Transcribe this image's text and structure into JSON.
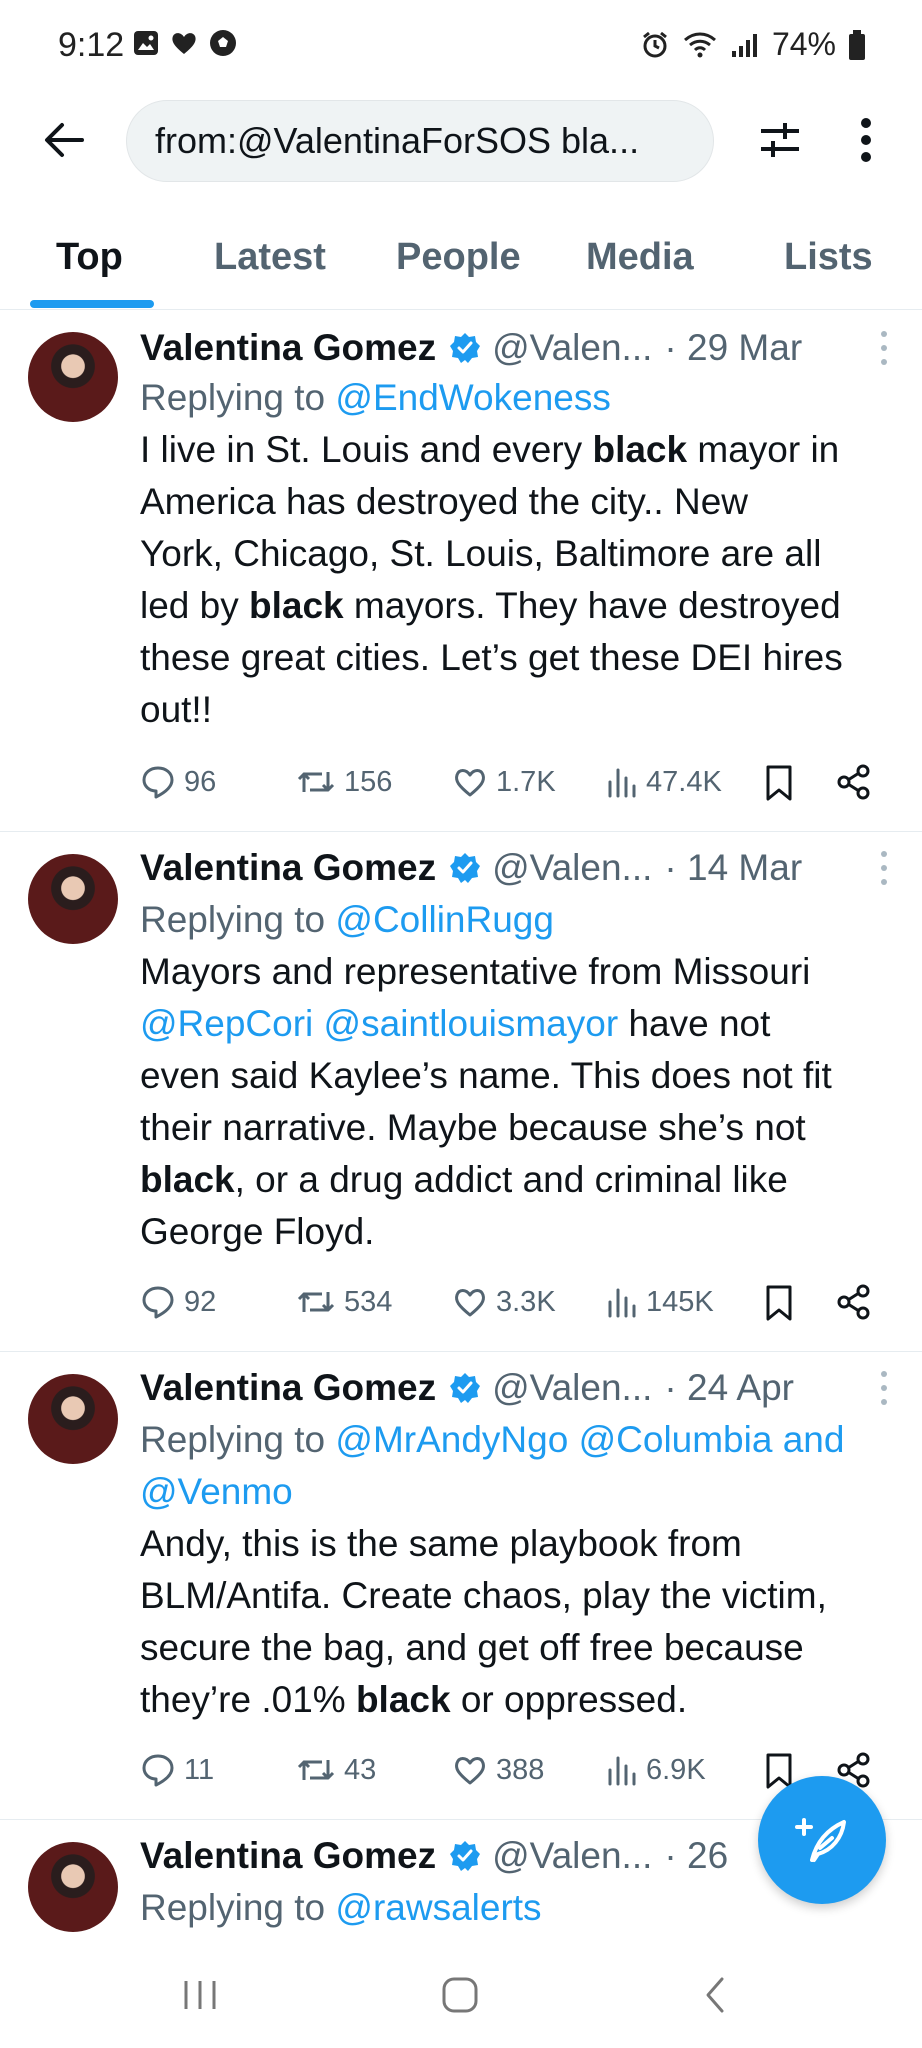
{
  "status_bar": {
    "time": "9:12",
    "battery": "74%"
  },
  "search": {
    "query": "from:@ValentinaForSOS bla..."
  },
  "tabs": [
    {
      "label": "Top",
      "active": true
    },
    {
      "label": "Latest",
      "active": false
    },
    {
      "label": "People",
      "active": false
    },
    {
      "label": "Media",
      "active": false
    },
    {
      "label": "Lists",
      "active": false
    }
  ],
  "tweets": [
    {
      "name": "Valentina Gomez",
      "handle": "@Valen...",
      "date": "· 29 Mar",
      "reply_prefix": "Replying to",
      "reply_mentions": "@EndWokeness",
      "body_lines": [
        [
          "I live in St. Louis and every ",
          "black",
          " mayor in"
        ],
        [
          "America has destroyed the city.. New"
        ],
        [
          "York, Chicago, St. Louis, Baltimore are all"
        ],
        [
          "led by ",
          "black",
          " mayors. They have destroyed"
        ],
        [
          "these great cities. Let’s get these DEI hires"
        ],
        [
          "out!!"
        ]
      ],
      "stats": {
        "replies": "96",
        "retweets": "156",
        "likes": "1.7K",
        "views": "47.4K"
      }
    },
    {
      "name": "Valentina Gomez",
      "handle": "@Valen...",
      "date": "· 14 Mar",
      "reply_prefix": "Replying to",
      "reply_mentions": "@CollinRugg",
      "body_line1": "Mayors and representative from Missouri",
      "body_mentions": "@RepCori @saintlouismayor",
      "body_after_mentions": " have not",
      "body_line3": "even said Kaylee’s name. This does not fit",
      "body_line4": "their narrative. Maybe because she’s not",
      "body_bold": "black",
      "body_line5_rest": ", or a drug addict and criminal like",
      "body_line6": "George Floyd.",
      "stats": {
        "replies": "92",
        "retweets": "534",
        "likes": "3.3K",
        "views": "145K"
      }
    },
    {
      "name": "Valentina Gomez",
      "handle": "@Valen...",
      "date": "· 24 Apr",
      "reply_prefix": "Replying to",
      "reply_mentions_line1": "@MrAndyNgo @Columbia and",
      "reply_mentions_line2": "@Venmo",
      "body_line1": "Andy, this is the same playbook from",
      "body_line2": "BLM/Antifa. Create chaos, play the victim,",
      "body_line3": "secure the bag, and get off free because",
      "body_line4_pre": "they’re .01% ",
      "body_bold": "black",
      "body_line4_post": " or oppressed.",
      "stats": {
        "replies": "11",
        "retweets": "43",
        "likes": "388",
        "views": "6.9K"
      }
    },
    {
      "name": "Valentina Gomez",
      "handle": "@Valen...",
      "date": "· 26",
      "reply_prefix": "Replying to",
      "reply_mentions": "@rawsalerts"
    }
  ],
  "colors": {
    "accent": "#1d9bf0",
    "text": "#0f1419",
    "secondary": "#536471",
    "divider": "#e6ecf0"
  },
  "icons": [
    "back-arrow-icon",
    "filter-sliders-icon",
    "more-vertical-icon",
    "verified-badge-icon",
    "reply-icon",
    "retweet-icon",
    "like-icon",
    "views-icon",
    "bookmark-icon",
    "share-icon",
    "compose-icon"
  ]
}
